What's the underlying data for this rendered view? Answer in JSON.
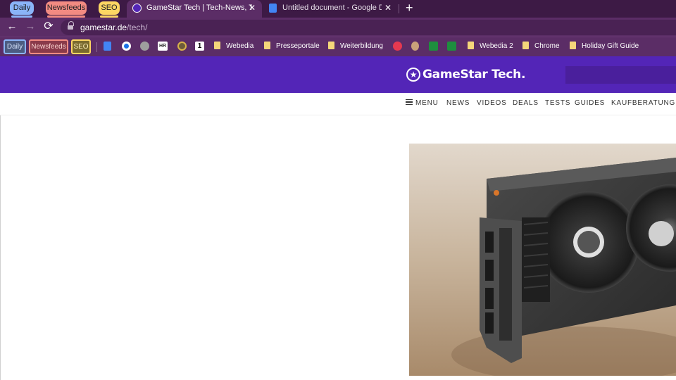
{
  "tabs": {
    "groups": [
      {
        "label": "Daily",
        "color": "#8ab4f8"
      },
      {
        "label": "Newsfeeds",
        "color": "#f28b82"
      },
      {
        "label": "SEO",
        "color": "#fdd663"
      }
    ],
    "open": [
      {
        "title": "GameStar Tech | Tech-News, Test",
        "favicon": "gamestar-icon",
        "active": true
      },
      {
        "title": "Untitled document - Google Doc",
        "favicon": "google-docs-icon",
        "active": false
      }
    ],
    "close_glyph": "✕",
    "new_tab_glyph": "+"
  },
  "toolbar": {
    "back_glyph": "←",
    "forward_glyph": "→",
    "reload_glyph": "⟳",
    "url_host": "gamestar.de",
    "url_path": "/tech/"
  },
  "bookmarks": {
    "groups": [
      {
        "label": "Daily",
        "color": "#8ab4f8"
      },
      {
        "label": "Newsfeeds",
        "color": "#f28b82"
      },
      {
        "label": "SEO",
        "color": "#fdd663"
      }
    ],
    "hr_label": "HR",
    "one_label": "1",
    "folders": [
      "Webedia",
      "Presseportale",
      "Weiterbildung",
      "Webedia 2",
      "Chrome",
      "Holiday Gift Guide"
    ]
  },
  "site": {
    "logo_text": "GameStar Tech.",
    "logo_star": "★",
    "brand_color": "#5325b7",
    "nav": [
      "MENU",
      "NEWS",
      "VIDEOS",
      "DEALS",
      "TESTS",
      "GUIDES",
      "KAUFBERATUNG"
    ]
  }
}
